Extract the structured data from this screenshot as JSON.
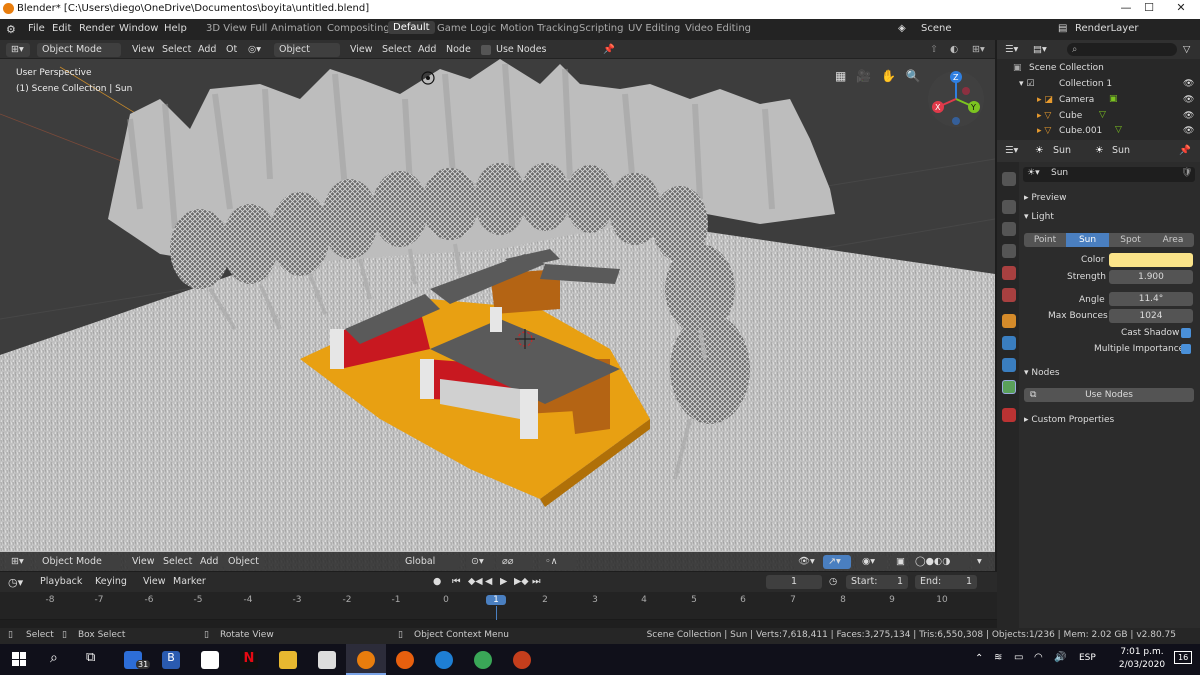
{
  "window": {
    "title": "Blender* [C:\\Users\\diego\\OneDrive\\Documentos\\boyita\\untitled.blend]"
  },
  "menu": [
    "File",
    "Edit",
    "Render",
    "Window",
    "Help"
  ],
  "workspaces": [
    "3D View Full",
    "Animation",
    "Compositing",
    "Default",
    "Game Logic",
    "Motion Tracking",
    "Scripting",
    "UV Editing",
    "Video Editing"
  ],
  "active_workspace": "Default",
  "scene": {
    "name": "Scene",
    "render_layer": "RenderLayer"
  },
  "header": {
    "mode": "Object Mode",
    "view": "View",
    "select": "Select",
    "add": "Add",
    "object_trunc": "Ot",
    "object_dd": "Object",
    "view2": "View",
    "select2": "Select",
    "add2": "Add",
    "node": "Node",
    "use_nodes": "Use Nodes"
  },
  "viewport": {
    "perspective": "User Perspective",
    "collection_info": "(1) Scene Collection | Sun"
  },
  "vp_footer": {
    "mode": "Object Mode",
    "view": "View",
    "select": "Select",
    "add": "Add",
    "object": "Object",
    "orientation": "Global"
  },
  "timeline": {
    "playback": "Playback",
    "keying": "Keying",
    "view": "View",
    "marker": "Marker",
    "current": "1",
    "start_label": "Start:",
    "start": "1",
    "end_label": "End:",
    "end": "1",
    "ticks": [
      "-8",
      "-7",
      "-6",
      "-5",
      "-4",
      "-3",
      "-2",
      "-1",
      "0",
      "1",
      "2",
      "3",
      "4",
      "5",
      "6",
      "7",
      "8",
      "9",
      "10"
    ]
  },
  "status": {
    "select": "Select",
    "box_select": "Box Select",
    "rotate": "Rotate View",
    "context": "Object Context Menu",
    "stats": "Scene Collection | Sun | Verts:7,618,411 | Faces:3,275,134 | Tris:6,550,308 | Objects:1/236 | Mem: 2.02 GB | v2.80.75"
  },
  "outliner": {
    "root": "Scene Collection",
    "collection": "Collection 1",
    "items": [
      "Camera",
      "Cube",
      "Cube.001"
    ]
  },
  "properties": {
    "breadcrumb_obj": "Sun",
    "breadcrumb_data": "Sun",
    "datablock": "Sun",
    "preview": "Preview",
    "light": "Light",
    "light_types": [
      "Point",
      "Sun",
      "Spot",
      "Area"
    ],
    "active_type": "Sun",
    "color_label": "Color",
    "color": "#fbe48a",
    "strength_label": "Strength",
    "strength": "1.900",
    "angle_label": "Angle",
    "angle": "11.4°",
    "bounces_label": "Max Bounces",
    "bounces": "1024",
    "cast_shadow": "Cast Shadow",
    "multi_importance": "Multiple Importance",
    "nodes": "Nodes",
    "use_nodes_btn": "Use Nodes",
    "custom_props": "Custom Properties"
  },
  "taskbar": {
    "time": "7:01 p.m.",
    "date": "2/03/2020",
    "lang": "ESP",
    "badge_mail": "31",
    "notif": "16"
  }
}
